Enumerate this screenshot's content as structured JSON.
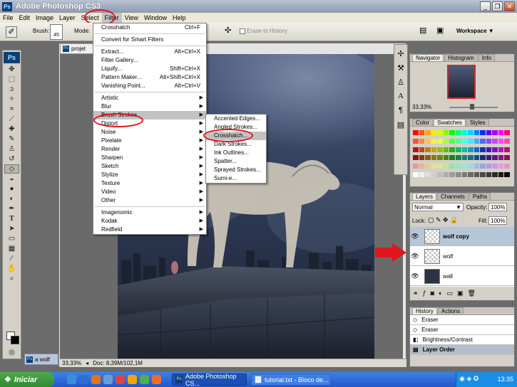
{
  "window": {
    "title": "Adobe Photoshop CS3",
    "app_icon": "Ps"
  },
  "menubar": [
    "File",
    "Edit",
    "Image",
    "Layer",
    "Select",
    "Filter",
    "View",
    "Window",
    "Help"
  ],
  "options_bar": {
    "brush_label": "Brush:",
    "brush_size": "45",
    "mode_label": "Mode:",
    "erase_to_history": "Erase to History",
    "workspace": "Workspace ▼"
  },
  "toolbox": {
    "logo": "Ps"
  },
  "document": {
    "tab_label": "projet",
    "zoom": "33,33%",
    "doc_info": "Doc: 8,39M/102,1M"
  },
  "filter_menu": {
    "items": [
      {
        "label": "Crosshatch",
        "shortcut": "Ctrl+F"
      },
      {
        "label": "Convert for Smart Filters"
      },
      {
        "label": "Extract...",
        "shortcut": "Alt+Ctrl+X"
      },
      {
        "label": "Filter Gallery..."
      },
      {
        "label": "Liquify...",
        "shortcut": "Shift+Ctrl+X"
      },
      {
        "label": "Pattern Maker...",
        "shortcut": "Alt+Shift+Ctrl+X"
      },
      {
        "label": "Vanishing Point...",
        "shortcut": "Alt+Ctrl+V"
      },
      {
        "label": "Artistic"
      },
      {
        "label": "Blur"
      },
      {
        "label": "Brush Strokes"
      },
      {
        "label": "Distort"
      },
      {
        "label": "Noise"
      },
      {
        "label": "Pixelate"
      },
      {
        "label": "Render"
      },
      {
        "label": "Sharpen"
      },
      {
        "label": "Sketch"
      },
      {
        "label": "Stylize"
      },
      {
        "label": "Texture"
      },
      {
        "label": "Video"
      },
      {
        "label": "Other"
      },
      {
        "label": "Imagenomic"
      },
      {
        "label": "Kodak"
      },
      {
        "label": "Redfield"
      }
    ]
  },
  "brush_strokes_submenu": [
    "Accented Edges...",
    "Angled Strokes...",
    "Crosshatch...",
    "Dark Strokes...",
    "Ink Outlines...",
    "Spatter...",
    "Sprayed Strokes...",
    "Sumi-e..."
  ],
  "navigator_panel": {
    "tabs": [
      "Navigator",
      "Histogram",
      "Info"
    ],
    "zoom": "33,33%"
  },
  "color_panel": {
    "tabs": [
      "Color",
      "Swatches",
      "Styles"
    ]
  },
  "layers_panel": {
    "tabs": [
      "Layers",
      "Channels",
      "Paths"
    ],
    "blend_mode": "Normal",
    "opacity_label": "Opacity:",
    "opacity": "100%",
    "lock_label": "Lock:",
    "fill_label": "Fill:",
    "fill": "100%",
    "layers": [
      {
        "name": "wolf copy",
        "selected": true
      },
      {
        "name": "wolf",
        "selected": false
      },
      {
        "name": "wall",
        "selected": false
      }
    ]
  },
  "history_panel": {
    "tabs": [
      "History",
      "Actions"
    ],
    "items": [
      {
        "label": "Eraser"
      },
      {
        "label": "Eraser"
      },
      {
        "label": "Brightness/Contrast"
      },
      {
        "label": "Layer Order",
        "selected": true
      }
    ]
  },
  "taskbar": {
    "start": "Iniciar",
    "items": [
      "Adobe Photoshop CS...",
      "tutorial.txt - Bloco de..."
    ],
    "clock": "13:35"
  },
  "minimized_doc": "a wolf",
  "colors": {
    "annotation": "#e0141c",
    "selection": "#c2c2c2"
  }
}
